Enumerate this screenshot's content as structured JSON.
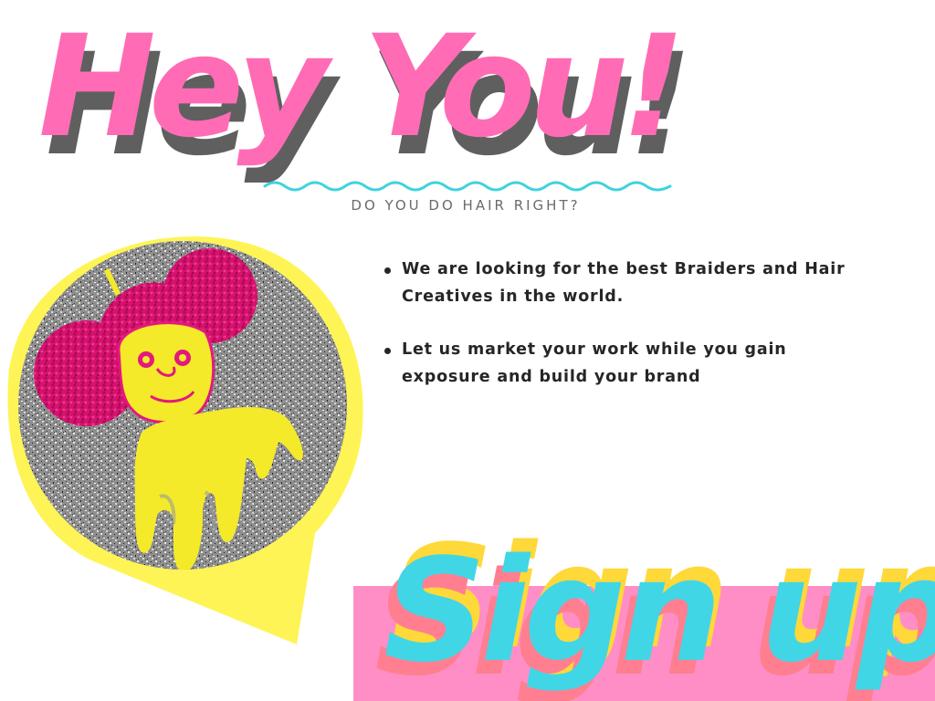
{
  "headline": {
    "text": "Hey You!",
    "color": "#ff6cb5",
    "shadow_color": "#5f5f5f"
  },
  "subtitle": {
    "text": "DO YOU DO HAIR RIGHT?"
  },
  "bullets": {
    "items": [
      "We are looking for the best Braiders and Hair Creatives in the world.",
      "Let us market your work while you gain exposure and build your brand"
    ]
  },
  "cta": {
    "label": "Sign up",
    "text_color": "#40d6e6",
    "shadow_color_1": "#ffd83a",
    "shadow_color_2": "#ff7f90",
    "band_color": "#ff8ec6"
  },
  "graphic": {
    "pin_color": "#fef456",
    "hair_color": "#e3197d",
    "face_color": "#f4ea29"
  },
  "icons": {
    "wave": "wavy-divider",
    "pin": "map-pin-shape",
    "bullet": "bullet-dot-icon"
  }
}
